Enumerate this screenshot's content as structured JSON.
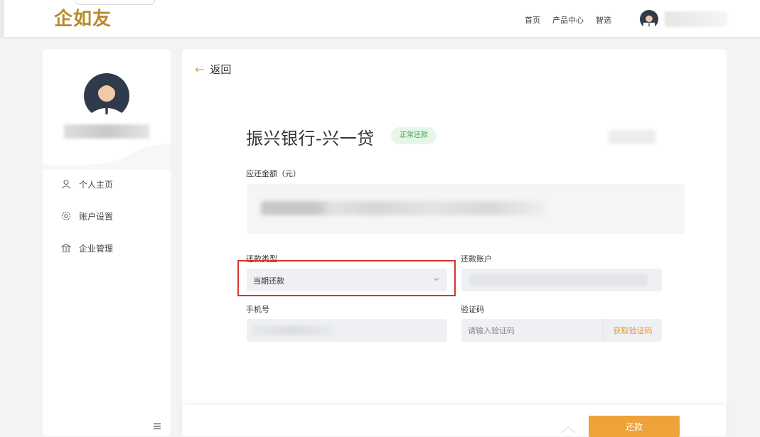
{
  "header": {
    "logo": "企如友",
    "nav": [
      "首页",
      "产品中心",
      "智选"
    ]
  },
  "sidebar": {
    "items": [
      {
        "label": "个人主页",
        "icon": "user-icon"
      },
      {
        "label": "账户设置",
        "icon": "settings-icon"
      },
      {
        "label": "企业管理",
        "icon": "bank-icon"
      }
    ]
  },
  "main": {
    "back_label": "返回",
    "product_title": "振兴银行-兴一贷",
    "status": "正常还款",
    "amount_label": "应还金额（元）",
    "form": {
      "repay_type_label": "还款类型",
      "repay_type_value": "当期还款",
      "repay_account_label": "还款账户",
      "phone_label": "手机号",
      "code_label": "验证码",
      "code_placeholder": "请输入验证码",
      "get_code_label": "获取验证码"
    },
    "submit_label": "还款"
  },
  "colors": {
    "brand": "#b98a2c",
    "accent": "#eda23a",
    "highlight": "#d9332e",
    "status_green": "#3aa552"
  }
}
